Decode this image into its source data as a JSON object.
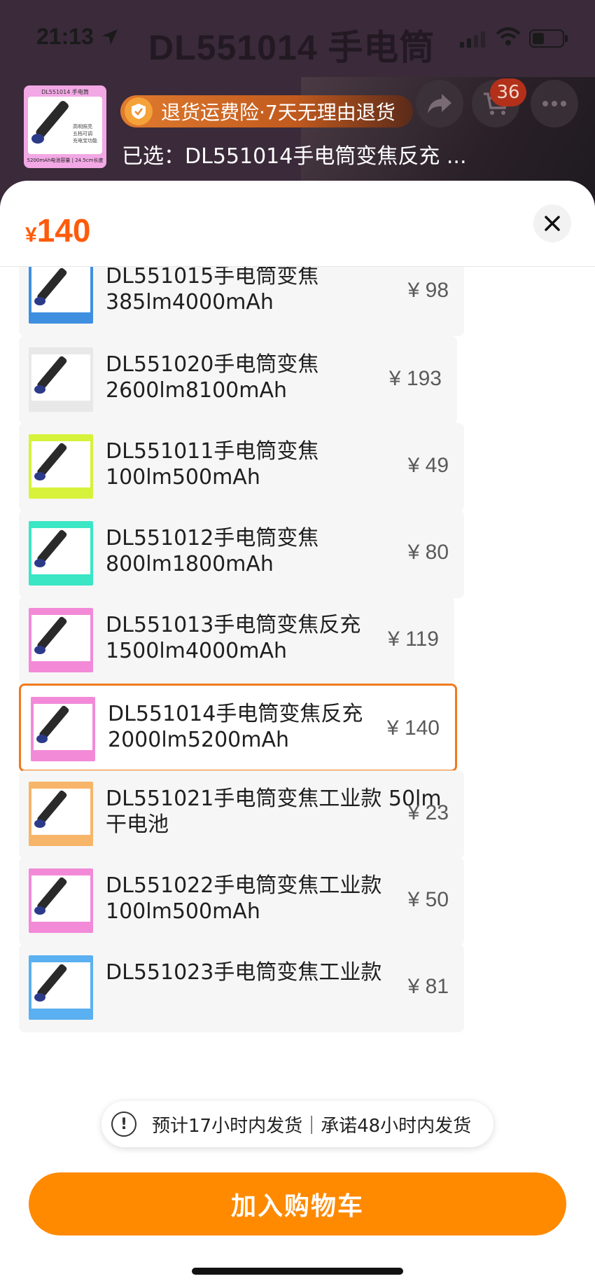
{
  "status_bar": {
    "time": "21:13"
  },
  "background": {
    "title": "DL551014 手电筒",
    "cart_count": "36"
  },
  "header": {
    "insurance": "退货运费险·7天无理由退货",
    "selected": "已选：DL551014手电筒变焦反充 ...",
    "thumb": {
      "title": "DL551014 手电筒",
      "caption": "5200mAh电池容量 | 24.5cm长度",
      "features": [
        "高明照亮",
        "五档可调",
        "充电宝功能"
      ]
    }
  },
  "sheet": {
    "currency": "¥",
    "price": "140"
  },
  "variants": [
    {
      "line1": "DL551015手电筒变焦",
      "line2": "385lm4000mAh",
      "price": "¥ 98",
      "thumb_color": "#3f8fe0",
      "selected": false
    },
    {
      "line1": "DL551020手电筒变焦",
      "line2": "2600lm8100mAh",
      "price": "¥ 193",
      "thumb_color": "#e8e8e8",
      "selected": false
    },
    {
      "line1": "DL551011手电筒变焦",
      "line2": "100lm500mAh",
      "price": "¥ 49",
      "thumb_color": "#d7f23a",
      "selected": false
    },
    {
      "line1": "DL551012手电筒变焦",
      "line2": "800lm1800mAh",
      "price": "¥ 80",
      "thumb_color": "#3ae6c4",
      "selected": false
    },
    {
      "line1": "DL551013手电筒变焦反充",
      "line2": "1500lm4000mAh",
      "price": "¥ 119",
      "thumb_color": "#f28ad8",
      "selected": false
    },
    {
      "line1": "DL551014手电筒变焦反充",
      "line2": "2000lm5200mAh",
      "price": "¥ 140",
      "thumb_color": "#f28ad8",
      "selected": true
    },
    {
      "line1": "DL551021手电筒变焦工业款 50lm",
      "line2": "干电池",
      "price": "¥ 23",
      "thumb_color": "#f7b56a",
      "selected": false
    },
    {
      "line1": "DL551022手电筒变焦工业款",
      "line2": "100lm500mAh",
      "price": "¥ 50",
      "thumb_color": "#f28ad8",
      "selected": false
    },
    {
      "line1": "DL551023手电筒变焦工业款",
      "line2": "",
      "price": "¥ 81",
      "thumb_color": "#5ab0f0",
      "selected": false
    }
  ],
  "shipping_notice": "预计17小时内发货｜承诺48小时内发货",
  "add_to_cart": "加入购物车",
  "colors": {
    "accent": "#ff8a00",
    "price": "#ff5b0a",
    "selected_border": "#f07a1e"
  }
}
